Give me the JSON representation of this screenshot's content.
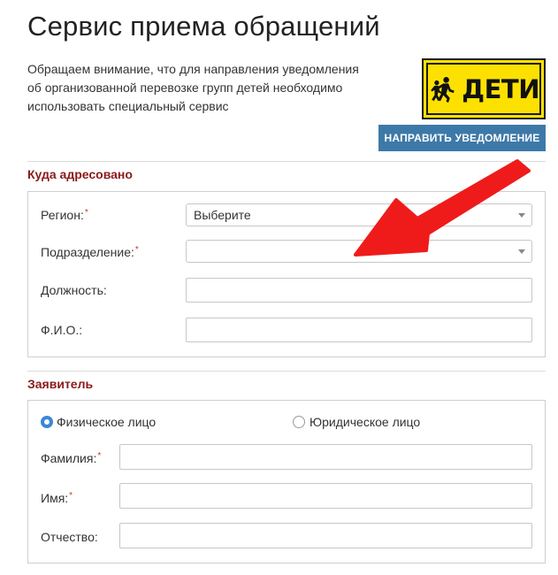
{
  "page": {
    "title": "Сервис приема обращений",
    "notice_lines": [
      "Обращаем внимание, что для направления уведомления",
      "об организованной перевозке групп детей необходимо",
      "использовать специальный сервис"
    ],
    "sign_text": "ДЕТИ",
    "send_button_label": "НАПРАВИТЬ УВЕДОМЛЕНИЕ"
  },
  "addressee": {
    "section_title": "Куда адресовано",
    "region_label": "Регион:",
    "region_value": "Выберите",
    "division_label": "Подразделение:",
    "division_value": "",
    "position_label": "Должность:",
    "position_value": "",
    "fio_label": "Ф.И.О.:",
    "fio_value": ""
  },
  "applicant": {
    "section_title": "Заявитель",
    "person_type_individual": "Физическое лицо",
    "person_type_legal": "Юридическое лицо",
    "selected_person_type": "individual",
    "surname_label": "Фамилия:",
    "surname_value": "",
    "name_label": "Имя:",
    "name_value": "",
    "patronymic_label": "Отчество:",
    "patronymic_value": ""
  },
  "required_mark": "*",
  "colors": {
    "accent_button": "#3d79a8",
    "section_title": "#8b1a1a",
    "sign_background": "#fce100",
    "annotation_arrow": "#ef1b1b",
    "radio_selected": "#3a87d6"
  },
  "icons": {
    "children_sign": "running-children-icon",
    "dropdown": "chevron-down-icon",
    "annotation": "red-arrow-annotation"
  }
}
